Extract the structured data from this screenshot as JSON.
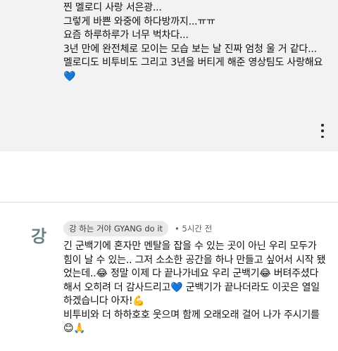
{
  "previous_comment": {
    "text": "찐 멜로디 사랑 서은광...\n그렇게 바쁜 와중에 하다방까지...ㅠㅠ\n요즘 하루하루가 너무 벅차다...\n3년 만에 완전체로 모이는 모습 보는 날 진짜 엄청 울 거 같다...\n멜로디도 비투비도 그리고 3년을 버티게 해준 영상팀도 사랑해요💙",
    "more_icon": "more-vertical-icon"
  },
  "comment": {
    "avatar_letter": "강",
    "author": "강 하는 거야 GYANG do it",
    "separator": "•",
    "time": "5시간 전",
    "text": "긴 군백기에 혼자만 멘탈을 잡을 수 있는 곳이 아닌 우리 모두가 힘이 날 수 있는.. 그저 소소한 공간을 하나 만들고 싶어서 시작 됐었는데..😂 정말 이제 다 끝나가네요 우리 군백기😂 버텨주셨다 해서 오히려 더 감사드리고💙 군백기가 끝나더라도 이곳은 열일하겠습니다 아자!💪\n비투비와 더 하하호호 웃으며 함께 오래오래 걸어 나가 주시기를😊🙏"
  }
}
